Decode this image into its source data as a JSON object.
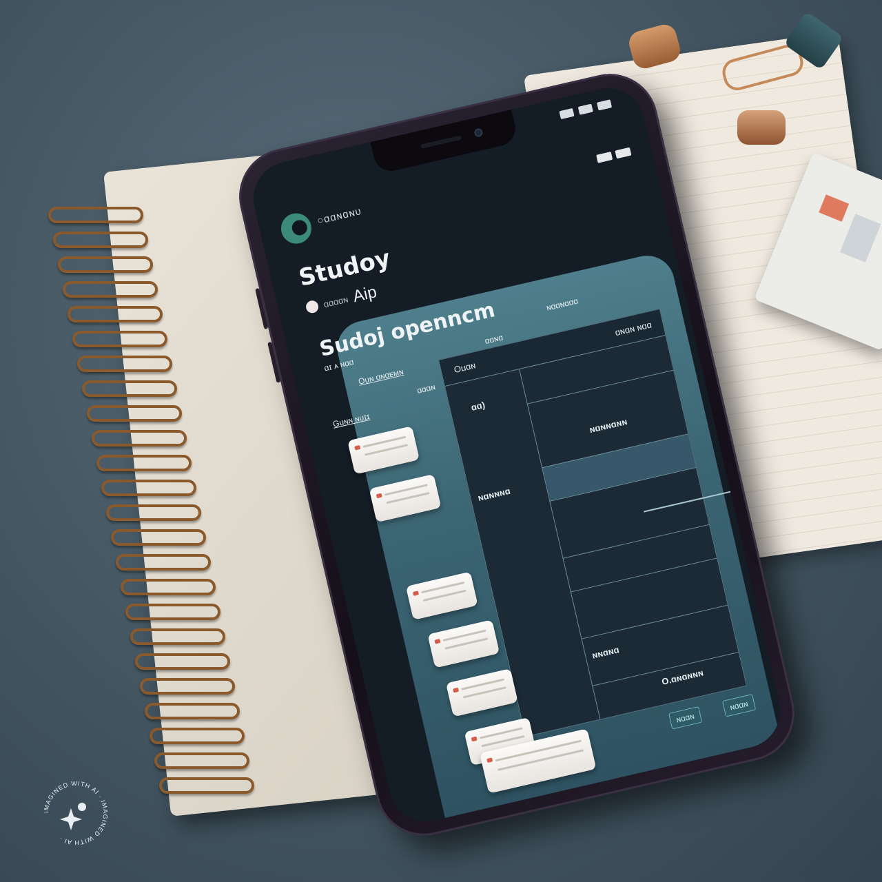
{
  "app": {
    "brand": "○ɑɑɴɑɴᴜ",
    "title": "Studoy",
    "subtitle": "Aip",
    "subtitle_small": "ɑɑɑɑɴ"
  },
  "panel": {
    "title": "Sudoj openncm",
    "subtitle": "ɑɪ ᴀ ɴɑɑ",
    "filter_label": "Ouɴ ɑɴɑᴇᴍɴ",
    "schedule_label": "Guɴɴ ɴᴜɪɪ",
    "col_labels": [
      "ɑɑɴɑ",
      "ɑɑɑɴ",
      "ɴɑɑɴɑɑɑ"
    ]
  },
  "grid": {
    "header_left": "Ouɑɴ",
    "header_right": "ɑɴɑɴ ɴɑɑ",
    "cells": [
      "ɑɑ)",
      "ɴɑɴɴɑɴɴ",
      "ɴɑɴɴɴɑ",
      "ɴɴɑɴɑ",
      "O.ɑɴɑɴɴɴ"
    ]
  },
  "buttons": {
    "primary": "ɴɑɑɴ",
    "secondary": "ɴɑɑɴ"
  },
  "watermark": {
    "text": "IMAGINED WITH AI · IMAGINED WITH AI ·"
  },
  "colors": {
    "panel": "#3c6674",
    "grid": "#1c2a36",
    "accent_dot": "#d35f4a",
    "logo": "#3c8a7a"
  }
}
